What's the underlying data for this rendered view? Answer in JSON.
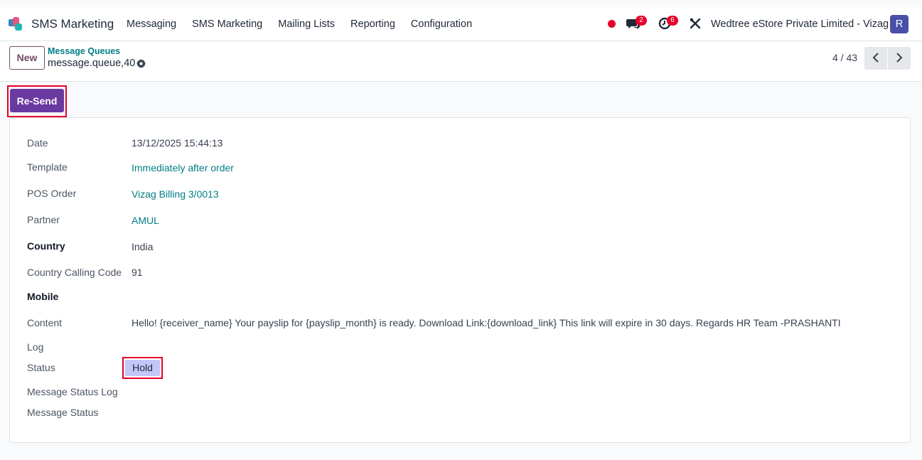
{
  "app": {
    "name": "SMS Marketing",
    "menu": [
      "Messaging",
      "SMS Marketing",
      "Mailing Lists",
      "Reporting",
      "Configuration"
    ],
    "chat_badge": "2",
    "activity_badge": "6",
    "company": "Wedtree eStore Private Limited - Vizag",
    "avatar_letter": "R"
  },
  "control": {
    "new_label": "New",
    "breadcrumb": "Message Queues",
    "record_name": "message.queue,40",
    "pager": "4 / 43"
  },
  "actions": {
    "resend_label": "Re-Send"
  },
  "form": {
    "date_label": "Date",
    "date_value": "13/12/2025 15:44:13",
    "template_label": "Template",
    "template_value": "Immediately after order",
    "pos_label": "POS Order",
    "pos_value": "Vizag Billing 3/0013",
    "partner_label": "Partner",
    "partner_value": "AMUL",
    "country_label": "Country",
    "country_value": "India",
    "calling_label": "Country Calling Code",
    "calling_value": "91",
    "mobile_label": "Mobile",
    "content_label": "Content",
    "content_value": "Hello! {receiver_name} Your payslip for {payslip_month} is ready. Download Link:{download_link} This link will expire in 30 days. Regards HR Team -PRASHANTI",
    "log_label": "Log",
    "status_label": "Status",
    "status_value": "Hold",
    "status_log_label": "Message Status Log",
    "message_status_label": "Message Status"
  }
}
